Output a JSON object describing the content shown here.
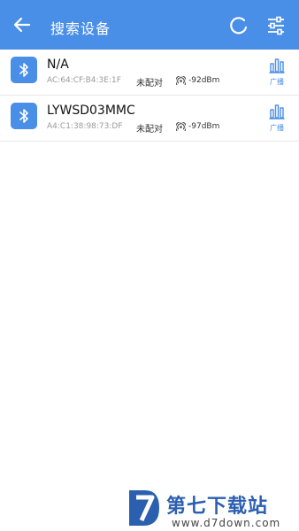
{
  "header": {
    "title": "搜索设备",
    "back_icon": "arrow-left-icon",
    "refresh_icon": "refresh-icon",
    "filter_icon": "sliders-icon",
    "background": "#4a8fe7"
  },
  "devices": [
    {
      "name": "N/A",
      "mac": "AC:64:CF:B4:3E:1F",
      "pair_status": "未配对",
      "rssi": "-92dBm",
      "action_label": "广播"
    },
    {
      "name": "LYWSD03MMC",
      "mac": "A4:C1:38:98:73:DF",
      "pair_status": "未配对",
      "rssi": "-97dBm",
      "action_label": "广播"
    }
  ],
  "watermark": {
    "brand": "第七下载站",
    "url": "www.d7down.com"
  },
  "colors": {
    "accent": "#4a8fe7",
    "brand": "#2b5fb0"
  }
}
